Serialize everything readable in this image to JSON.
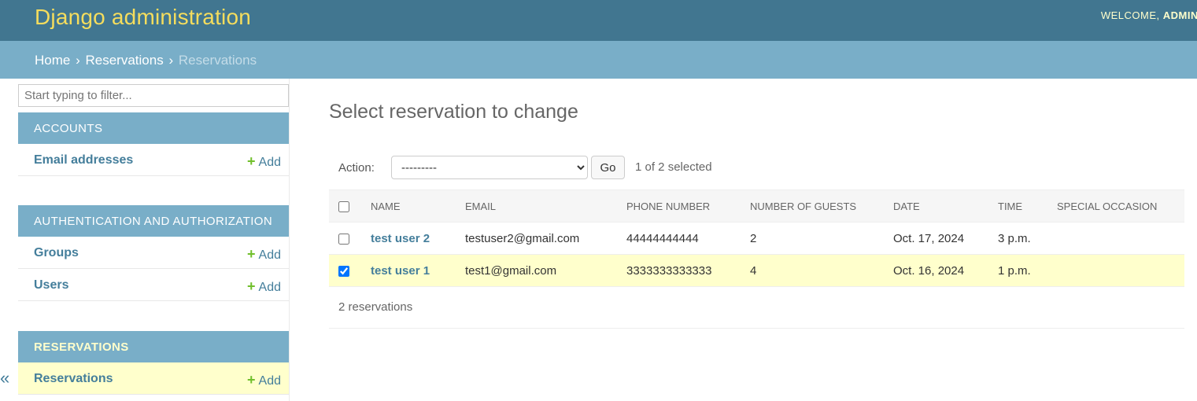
{
  "header": {
    "site_name": "Django administration",
    "welcome": "WELCOME,",
    "username": "ADMIN."
  },
  "breadcrumbs": {
    "home": "Home",
    "app": "Reservations",
    "current": "Reservations",
    "sep": "›"
  },
  "sidebar": {
    "filter_placeholder": "Start typing to filter...",
    "toggle": "«",
    "add_label": "Add",
    "add_icon": "plus-icon",
    "modules": [
      {
        "caption": "Accounts",
        "models": [
          {
            "name": "Email addresses"
          }
        ]
      },
      {
        "caption": "Authentication and Authorization",
        "models": [
          {
            "name": "Groups"
          },
          {
            "name": "Users"
          }
        ]
      },
      {
        "caption": "Reservations",
        "current": true,
        "models": [
          {
            "name": "Reservations",
            "current": true
          }
        ]
      }
    ]
  },
  "main": {
    "title": "Select reservation to change",
    "action_label": "Action:",
    "action_selected": "---------",
    "go_label": "Go",
    "counter": "1 of 2 selected",
    "columns": [
      "Name",
      "Email",
      "Phone number",
      "Number of guests",
      "Date",
      "Time",
      "Special occasion"
    ],
    "rows": [
      {
        "name": "test user 2",
        "email": "testuser2@gmail.com",
        "phone": "44444444444",
        "guests": "2",
        "date": "Oct. 17, 2024",
        "time": "3 p.m.",
        "occasion": "",
        "checked": false
      },
      {
        "name": "test user 1",
        "email": "test1@gmail.com",
        "phone": "3333333333333",
        "guests": "4",
        "date": "Oct. 16, 2024",
        "time": "1 p.m.",
        "occasion": "",
        "checked": true
      }
    ],
    "paginator": "2 reservations"
  },
  "colors": {
    "header_bg": "#417690",
    "breadcrumbs_bg": "#79aec8",
    "branding": "#f5dd5d",
    "link": "#447e9b",
    "add_icon": "#70bf2b",
    "selected_row": "#ffffcc"
  }
}
